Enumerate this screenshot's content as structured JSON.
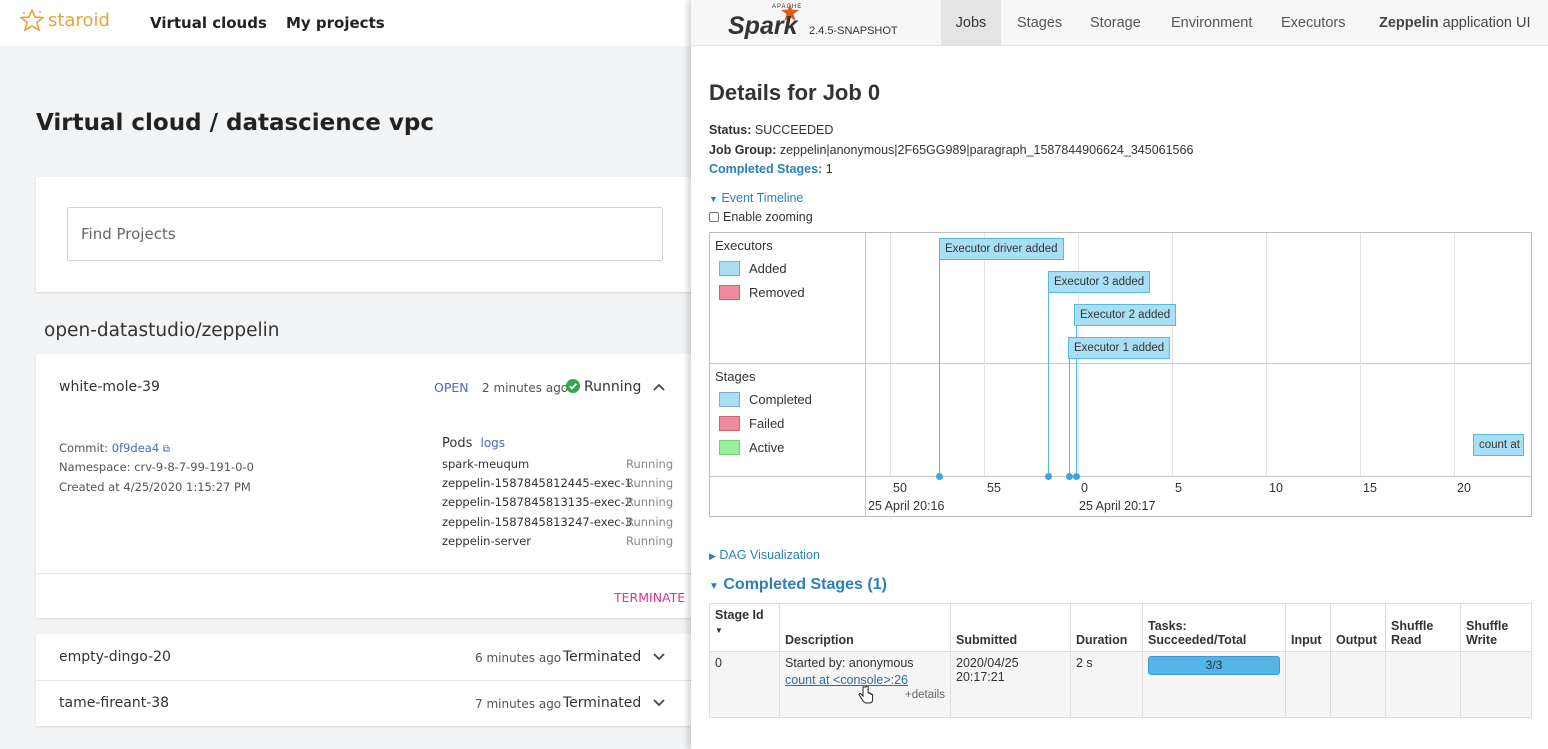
{
  "staroid": {
    "brand": "staroid",
    "nav": [
      "Virtual clouds",
      "My projects"
    ],
    "page_title": "Virtual cloud / datascience vpc",
    "search_placeholder": "Find Projects",
    "group_title": "open-datastudio/zeppelin",
    "projects": [
      {
        "name": "white-mole-39",
        "open_label": "OPEN",
        "time": "2 minutes ago",
        "status": "Running",
        "commit_label": "Commit:",
        "commit": "0f9dea4",
        "namespace": "Namespace: crv-9-8-7-99-191-0-0",
        "created": "Created at 4/25/2020 1:15:27 PM",
        "pods_label": "Pods",
        "logs_label": "logs",
        "pods": [
          {
            "name": "spark-meuqum",
            "status": "Running"
          },
          {
            "name": "zeppelin-1587845812445-exec-1",
            "status": "Running"
          },
          {
            "name": "zeppelin-1587845813135-exec-2",
            "status": "Running"
          },
          {
            "name": "zeppelin-1587845813247-exec-3",
            "status": "Running"
          },
          {
            "name": "zeppelin-server",
            "status": "Running"
          }
        ],
        "terminate": "TERMINATE"
      },
      {
        "name": "empty-dingo-20",
        "time": "6 minutes ago",
        "status": "Terminated"
      },
      {
        "name": "tame-fireant-38",
        "time": "7 minutes ago",
        "status": "Terminated"
      }
    ]
  },
  "spark": {
    "logo_text": "Spark",
    "apache_text": "APACHE",
    "version": "2.4.5-SNAPSHOT",
    "tabs": [
      "Jobs",
      "Stages",
      "Storage",
      "Environment",
      "Executors"
    ],
    "app_ui": {
      "bold": "Zeppelin",
      "rest": " application UI"
    },
    "title": "Details for Job 0",
    "status_label": "Status:",
    "status": "SUCCEEDED",
    "job_group_label": "Job Group:",
    "job_group": "zeppelin|anonymous|2F65GG989|paragraph_1587844906624_345061566",
    "completed_stages_label": "Completed Stages:",
    "completed_stages": "1",
    "event_timeline": "Event Timeline",
    "enable_zooming": "Enable zooming",
    "timeline": {
      "executors_label": "Executors",
      "added": "Added",
      "removed": "Removed",
      "stages_label": "Stages",
      "completed": "Completed",
      "failed": "Failed",
      "active": "Active",
      "events": [
        "Executor driver added",
        "Executor 3 added",
        "Executor 2 added",
        "Executor 1 added"
      ],
      "stage_event": "count at",
      "ticks": [
        "50",
        "55",
        "0",
        "5",
        "10",
        "15",
        "20"
      ],
      "dates": [
        "25 April 20:16",
        "25 April 20:17"
      ],
      "colors": {
        "added": "#a9dff5",
        "removed": "#f08aa0",
        "completed": "#a9dff5",
        "failed": "#f08aa0",
        "active": "#99ee99"
      }
    },
    "dag": "DAG Visualization",
    "completed_header": "Completed Stages (1)",
    "table": {
      "headers": [
        "Stage Id",
        "Description",
        "Submitted",
        "Duration",
        "Tasks: Succeeded/Total",
        "Input",
        "Output",
        "Shuffle Read",
        "Shuffle Write"
      ],
      "row": {
        "id": "0",
        "desc1": "Started by: anonymous",
        "desc_link": "count at <console>:26",
        "details": "+details",
        "submitted1": "2020/04/25",
        "submitted2": "20:17:21",
        "duration": "2 s",
        "tasks": "3/3",
        "tasks_fraction": 1.0
      }
    }
  }
}
